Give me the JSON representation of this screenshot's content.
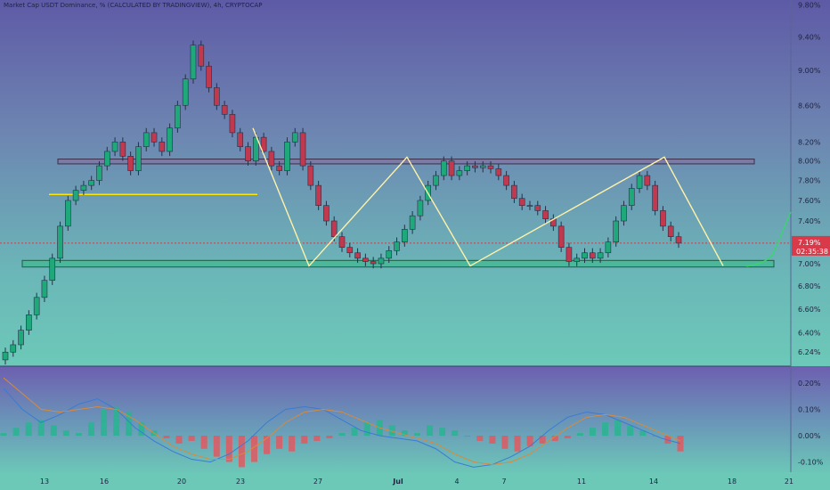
{
  "chart_data": {
    "type": "candlestick",
    "title": "Market Cap USDT Dominance, % (CALCULATED BY TRADINGVIEW), 4h, CRYPTOCAP",
    "price_axis": {
      "ticks": [
        "9.80%",
        "9.40%",
        "9.00%",
        "8.60%",
        "8.20%",
        "8.00%",
        "7.80%",
        "7.60%",
        "7.40%",
        "7.00%",
        "6.80%",
        "6.60%",
        "6.40%",
        "6.24%"
      ],
      "tick_values": [
        9.8,
        9.4,
        9.0,
        8.6,
        8.2,
        8.0,
        7.8,
        7.6,
        7.4,
        7.0,
        6.8,
        6.6,
        6.4,
        6.24
      ],
      "scale": "log"
    },
    "time_axis": {
      "labels": [
        "13",
        "16",
        "20",
        "23",
        "27",
        "Jul",
        "4",
        "7",
        "11",
        "14",
        "18",
        "21"
      ]
    },
    "current": {
      "price": "7.19%",
      "countdown": "02:35:38",
      "value": 7.19
    },
    "zones": [
      {
        "name": "resistance",
        "low": 7.97,
        "high": 8.02
      },
      {
        "name": "support",
        "low": 6.97,
        "high": 7.03
      }
    ],
    "support_line": {
      "value": 7.66
    },
    "path_points": [
      {
        "label": "23",
        "value": 8.35
      },
      {
        "label": "27",
        "value": 6.98
      },
      {
        "label": "Jul",
        "value": 8.04
      },
      {
        "label": "7",
        "value": 6.98
      },
      {
        "label": "14",
        "value": 8.04
      },
      {
        "label": "18",
        "value": 6.98
      }
    ],
    "candles_close": [
      6.24,
      6.3,
      6.42,
      6.55,
      6.7,
      6.85,
      7.05,
      7.35,
      7.6,
      7.7,
      7.75,
      7.8,
      7.95,
      8.1,
      8.2,
      8.05,
      7.9,
      8.15,
      8.3,
      8.2,
      8.1,
      8.35,
      8.6,
      8.9,
      9.3,
      9.05,
      8.8,
      8.6,
      8.5,
      8.3,
      8.15,
      8.0,
      8.25,
      8.1,
      7.95,
      7.9,
      8.2,
      8.3,
      7.95,
      7.75,
      7.55,
      7.4,
      7.25,
      7.15,
      7.1,
      7.05,
      7.02,
      7.0,
      7.05,
      7.12,
      7.2,
      7.32,
      7.45,
      7.6,
      7.75,
      7.85,
      8.0,
      7.85,
      7.9,
      7.95,
      7.93,
      7.95,
      7.92,
      7.85,
      7.75,
      7.62,
      7.55,
      7.55,
      7.5,
      7.42,
      7.35,
      7.15,
      7.02,
      7.05,
      7.1,
      7.05,
      7.1,
      7.2,
      7.4,
      7.55,
      7.72,
      7.85,
      7.75,
      7.5,
      7.35,
      7.25,
      7.19
    ],
    "macd": {
      "axis_ticks": [
        "0.20%",
        "0.10%",
        "0.00%",
        "-0.10%"
      ],
      "tick_values": [
        0.2,
        0.1,
        0.0,
        -0.1
      ],
      "histogram": [
        0.01,
        0.03,
        0.05,
        0.06,
        0.04,
        0.02,
        0.01,
        0.05,
        0.1,
        0.11,
        0.09,
        0.05,
        0.02,
        -0.01,
        -0.03,
        -0.02,
        -0.05,
        -0.08,
        -0.1,
        -0.12,
        -0.1,
        -0.07,
        -0.05,
        -0.06,
        -0.03,
        -0.02,
        -0.01,
        0.01,
        0.03,
        0.05,
        0.06,
        0.04,
        0.02,
        0.01,
        0.04,
        0.03,
        0.02,
        0.0,
        -0.02,
        -0.03,
        -0.05,
        -0.06,
        -0.04,
        -0.03,
        -0.02,
        -0.01,
        0.01,
        0.03,
        0.05,
        0.06,
        0.04,
        0.02,
        0.0,
        -0.03,
        -0.06
      ],
      "macd_line": [
        0.18,
        0.1,
        0.05,
        0.08,
        0.12,
        0.14,
        0.1,
        0.03,
        -0.02,
        -0.06,
        -0.09,
        -0.1,
        -0.07,
        -0.02,
        0.05,
        0.1,
        0.11,
        0.1,
        0.06,
        0.02,
        0.0,
        -0.01,
        -0.02,
        -0.05,
        -0.1,
        -0.12,
        -0.11,
        -0.08,
        -0.04,
        0.02,
        0.07,
        0.09,
        0.08,
        0.05,
        0.02,
        -0.01,
        -0.03
      ],
      "signal_line": [
        0.22,
        0.16,
        0.1,
        0.09,
        0.1,
        0.11,
        0.1,
        0.06,
        0.01,
        -0.04,
        -0.07,
        -0.09,
        -0.09,
        -0.06,
        -0.01,
        0.05,
        0.09,
        0.1,
        0.09,
        0.06,
        0.03,
        0.01,
        -0.01,
        -0.03,
        -0.07,
        -0.1,
        -0.11,
        -0.1,
        -0.07,
        -0.02,
        0.03,
        0.07,
        0.08,
        0.07,
        0.04,
        0.01,
        -0.02
      ]
    },
    "colors": {
      "bull": "#1fa97a",
      "bear": "#c0394e",
      "path": "#fff2a8",
      "support_line": "#ffe600",
      "resistance_zone": "#8a6a9a",
      "support_zone": "#39b98a",
      "current_price": "#d93a4a",
      "forecast": "#37d86a"
    },
    "grid": false
  }
}
